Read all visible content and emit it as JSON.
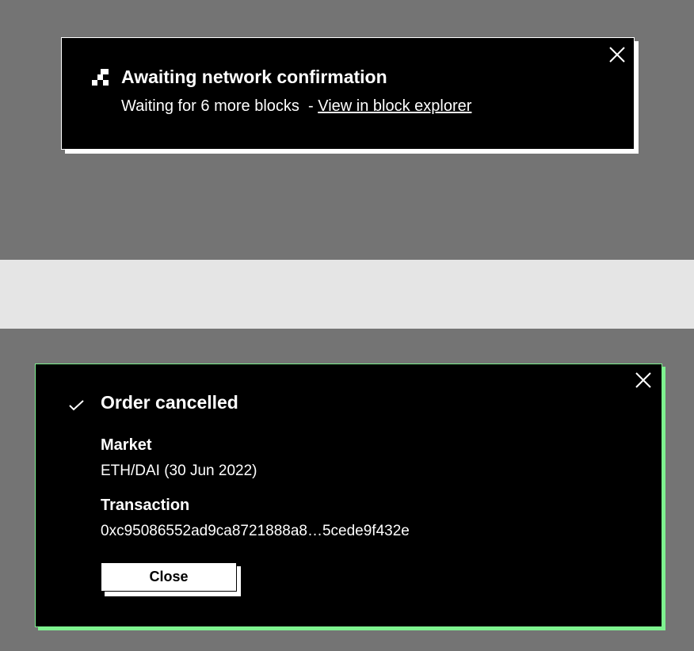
{
  "toast_pending": {
    "title": "Awaiting network confirmation",
    "message": "Waiting for 6 more blocks  - ",
    "link": "View in block explorer",
    "icon": "pending-blocks-icon",
    "close_icon": "close-icon",
    "border_color": "#ffffff"
  },
  "toast_success": {
    "title": "Order cancelled",
    "icon": "check-icon",
    "close_icon": "close-icon",
    "market_label": "Market",
    "market_value": "ETH/DAI (30 Jun 2022)",
    "transaction_label": "Transaction",
    "transaction_value": "0xc95086552ad9ca8721888a8…5cede9f432e",
    "close_button": "Close",
    "accent_color": "#7ef28f"
  }
}
